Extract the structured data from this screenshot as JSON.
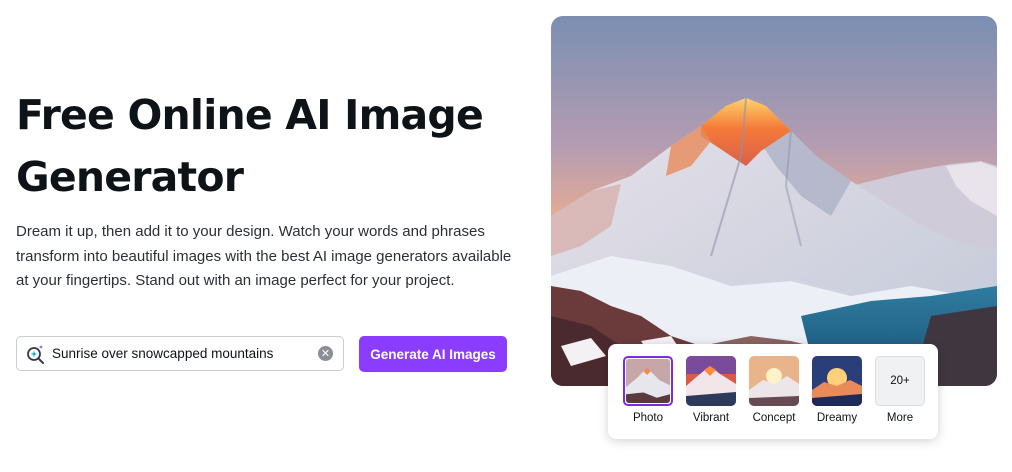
{
  "hero": {
    "title": "Free Online AI Image Generator",
    "description": "Dream it up, then add it to your design. Watch your words and phrases transform into beautiful images with the best AI image generators available at your fingertips. Stand out with an image perfect for your project."
  },
  "search": {
    "value": "Sunrise over snowcapped mountains",
    "clear_icon": "clear-circle-icon",
    "leading_icon": "magic-search-icon"
  },
  "generate_button": {
    "label": "Generate AI Images"
  },
  "styles": {
    "options": [
      {
        "label": "Photo",
        "selected": true
      },
      {
        "label": "Vibrant",
        "selected": false
      },
      {
        "label": "Concept",
        "selected": false
      },
      {
        "label": "Dreamy",
        "selected": false
      }
    ],
    "more": {
      "count": "20+",
      "label": "More"
    }
  },
  "colors": {
    "accent": "#8b3dff",
    "selected_border": "#7d2ae8",
    "text": "#0e1318"
  }
}
